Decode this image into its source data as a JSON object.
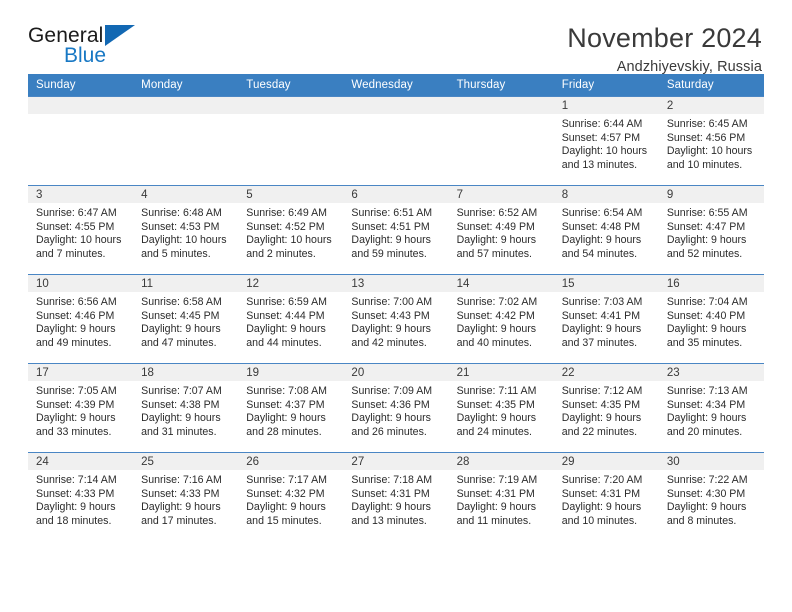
{
  "brand": {
    "word_one": "General",
    "word_two": "Blue",
    "flag_icon": "blue-triangle-flag-icon",
    "accent_color": "#1268b3"
  },
  "header": {
    "month_title": "November 2024",
    "location": "Andzhiyevskiy, Russia"
  },
  "calendar": {
    "header_bg": "#3a7fc1",
    "daynum_bg": "#f0f0f0",
    "row_border": "#4a86c4",
    "weekday_headers": [
      "Sunday",
      "Monday",
      "Tuesday",
      "Wednesday",
      "Thursday",
      "Friday",
      "Saturday"
    ],
    "weeks": [
      [
        {
          "day": "",
          "empty": true
        },
        {
          "day": "",
          "empty": true
        },
        {
          "day": "",
          "empty": true
        },
        {
          "day": "",
          "empty": true
        },
        {
          "day": "",
          "empty": true
        },
        {
          "day": "1",
          "sunrise": "Sunrise: 6:44 AM",
          "sunset": "Sunset: 4:57 PM",
          "daylight": "Daylight: 10 hours and 13 minutes."
        },
        {
          "day": "2",
          "sunrise": "Sunrise: 6:45 AM",
          "sunset": "Sunset: 4:56 PM",
          "daylight": "Daylight: 10 hours and 10 minutes."
        }
      ],
      [
        {
          "day": "3",
          "sunrise": "Sunrise: 6:47 AM",
          "sunset": "Sunset: 4:55 PM",
          "daylight": "Daylight: 10 hours and 7 minutes."
        },
        {
          "day": "4",
          "sunrise": "Sunrise: 6:48 AM",
          "sunset": "Sunset: 4:53 PM",
          "daylight": "Daylight: 10 hours and 5 minutes."
        },
        {
          "day": "5",
          "sunrise": "Sunrise: 6:49 AM",
          "sunset": "Sunset: 4:52 PM",
          "daylight": "Daylight: 10 hours and 2 minutes."
        },
        {
          "day": "6",
          "sunrise": "Sunrise: 6:51 AM",
          "sunset": "Sunset: 4:51 PM",
          "daylight": "Daylight: 9 hours and 59 minutes."
        },
        {
          "day": "7",
          "sunrise": "Sunrise: 6:52 AM",
          "sunset": "Sunset: 4:49 PM",
          "daylight": "Daylight: 9 hours and 57 minutes."
        },
        {
          "day": "8",
          "sunrise": "Sunrise: 6:54 AM",
          "sunset": "Sunset: 4:48 PM",
          "daylight": "Daylight: 9 hours and 54 minutes."
        },
        {
          "day": "9",
          "sunrise": "Sunrise: 6:55 AM",
          "sunset": "Sunset: 4:47 PM",
          "daylight": "Daylight: 9 hours and 52 minutes."
        }
      ],
      [
        {
          "day": "10",
          "sunrise": "Sunrise: 6:56 AM",
          "sunset": "Sunset: 4:46 PM",
          "daylight": "Daylight: 9 hours and 49 minutes."
        },
        {
          "day": "11",
          "sunrise": "Sunrise: 6:58 AM",
          "sunset": "Sunset: 4:45 PM",
          "daylight": "Daylight: 9 hours and 47 minutes."
        },
        {
          "day": "12",
          "sunrise": "Sunrise: 6:59 AM",
          "sunset": "Sunset: 4:44 PM",
          "daylight": "Daylight: 9 hours and 44 minutes."
        },
        {
          "day": "13",
          "sunrise": "Sunrise: 7:00 AM",
          "sunset": "Sunset: 4:43 PM",
          "daylight": "Daylight: 9 hours and 42 minutes."
        },
        {
          "day": "14",
          "sunrise": "Sunrise: 7:02 AM",
          "sunset": "Sunset: 4:42 PM",
          "daylight": "Daylight: 9 hours and 40 minutes."
        },
        {
          "day": "15",
          "sunrise": "Sunrise: 7:03 AM",
          "sunset": "Sunset: 4:41 PM",
          "daylight": "Daylight: 9 hours and 37 minutes."
        },
        {
          "day": "16",
          "sunrise": "Sunrise: 7:04 AM",
          "sunset": "Sunset: 4:40 PM",
          "daylight": "Daylight: 9 hours and 35 minutes."
        }
      ],
      [
        {
          "day": "17",
          "sunrise": "Sunrise: 7:05 AM",
          "sunset": "Sunset: 4:39 PM",
          "daylight": "Daylight: 9 hours and 33 minutes."
        },
        {
          "day": "18",
          "sunrise": "Sunrise: 7:07 AM",
          "sunset": "Sunset: 4:38 PM",
          "daylight": "Daylight: 9 hours and 31 minutes."
        },
        {
          "day": "19",
          "sunrise": "Sunrise: 7:08 AM",
          "sunset": "Sunset: 4:37 PM",
          "daylight": "Daylight: 9 hours and 28 minutes."
        },
        {
          "day": "20",
          "sunrise": "Sunrise: 7:09 AM",
          "sunset": "Sunset: 4:36 PM",
          "daylight": "Daylight: 9 hours and 26 minutes."
        },
        {
          "day": "21",
          "sunrise": "Sunrise: 7:11 AM",
          "sunset": "Sunset: 4:35 PM",
          "daylight": "Daylight: 9 hours and 24 minutes."
        },
        {
          "day": "22",
          "sunrise": "Sunrise: 7:12 AM",
          "sunset": "Sunset: 4:35 PM",
          "daylight": "Daylight: 9 hours and 22 minutes."
        },
        {
          "day": "23",
          "sunrise": "Sunrise: 7:13 AM",
          "sunset": "Sunset: 4:34 PM",
          "daylight": "Daylight: 9 hours and 20 minutes."
        }
      ],
      [
        {
          "day": "24",
          "sunrise": "Sunrise: 7:14 AM",
          "sunset": "Sunset: 4:33 PM",
          "daylight": "Daylight: 9 hours and 18 minutes."
        },
        {
          "day": "25",
          "sunrise": "Sunrise: 7:16 AM",
          "sunset": "Sunset: 4:33 PM",
          "daylight": "Daylight: 9 hours and 17 minutes."
        },
        {
          "day": "26",
          "sunrise": "Sunrise: 7:17 AM",
          "sunset": "Sunset: 4:32 PM",
          "daylight": "Daylight: 9 hours and 15 minutes."
        },
        {
          "day": "27",
          "sunrise": "Sunrise: 7:18 AM",
          "sunset": "Sunset: 4:31 PM",
          "daylight": "Daylight: 9 hours and 13 minutes."
        },
        {
          "day": "28",
          "sunrise": "Sunrise: 7:19 AM",
          "sunset": "Sunset: 4:31 PM",
          "daylight": "Daylight: 9 hours and 11 minutes."
        },
        {
          "day": "29",
          "sunrise": "Sunrise: 7:20 AM",
          "sunset": "Sunset: 4:31 PM",
          "daylight": "Daylight: 9 hours and 10 minutes."
        },
        {
          "day": "30",
          "sunrise": "Sunrise: 7:22 AM",
          "sunset": "Sunset: 4:30 PM",
          "daylight": "Daylight: 9 hours and 8 minutes."
        }
      ]
    ]
  }
}
